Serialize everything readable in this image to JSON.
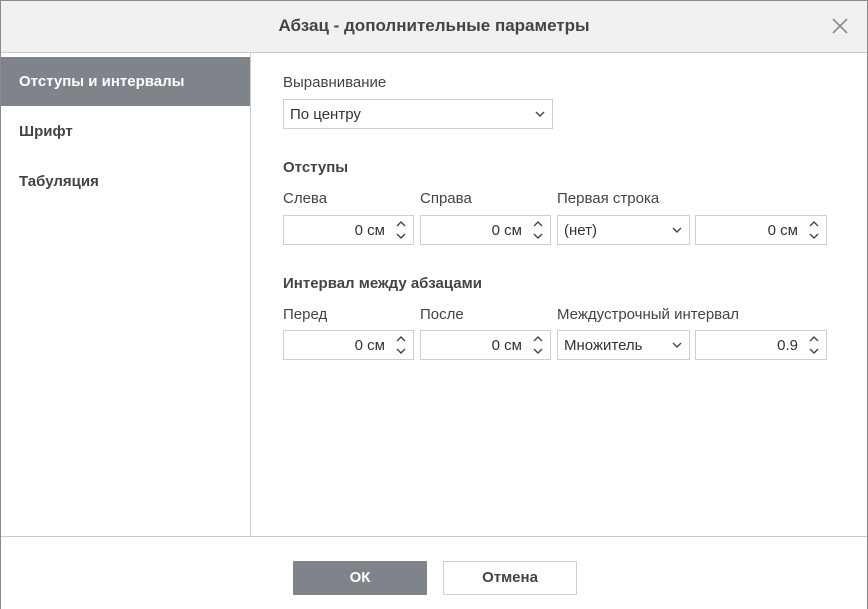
{
  "dialog": {
    "title": "Абзац - дополнительные параметры",
    "close_icon": "close-icon"
  },
  "sidebar": {
    "items": [
      {
        "label": "Отступы и интервалы",
        "active": true
      },
      {
        "label": "Шрифт",
        "active": false
      },
      {
        "label": "Табуляция",
        "active": false
      }
    ]
  },
  "alignment": {
    "label": "Выравнивание",
    "value": "По центру"
  },
  "indents": {
    "section": "Отступы",
    "left": {
      "label": "Слева",
      "value": "0 см"
    },
    "right": {
      "label": "Справа",
      "value": "0 см"
    },
    "first_line": {
      "label": "Первая строка",
      "type": "(нет)",
      "value": "0 см"
    }
  },
  "spacing": {
    "section": "Интервал между абзацами",
    "before": {
      "label": "Перед",
      "value": "0 см"
    },
    "after": {
      "label": "После",
      "value": "0 см"
    },
    "line": {
      "label": "Междустрочный интервал",
      "type": "Множитель",
      "value": "0.9"
    }
  },
  "footer": {
    "ok_label": "ОК",
    "cancel_label": "Отмена"
  },
  "colors": {
    "accent": "#7e848a",
    "border": "#cfcfcf",
    "title_bar": "#f1f1f1"
  }
}
